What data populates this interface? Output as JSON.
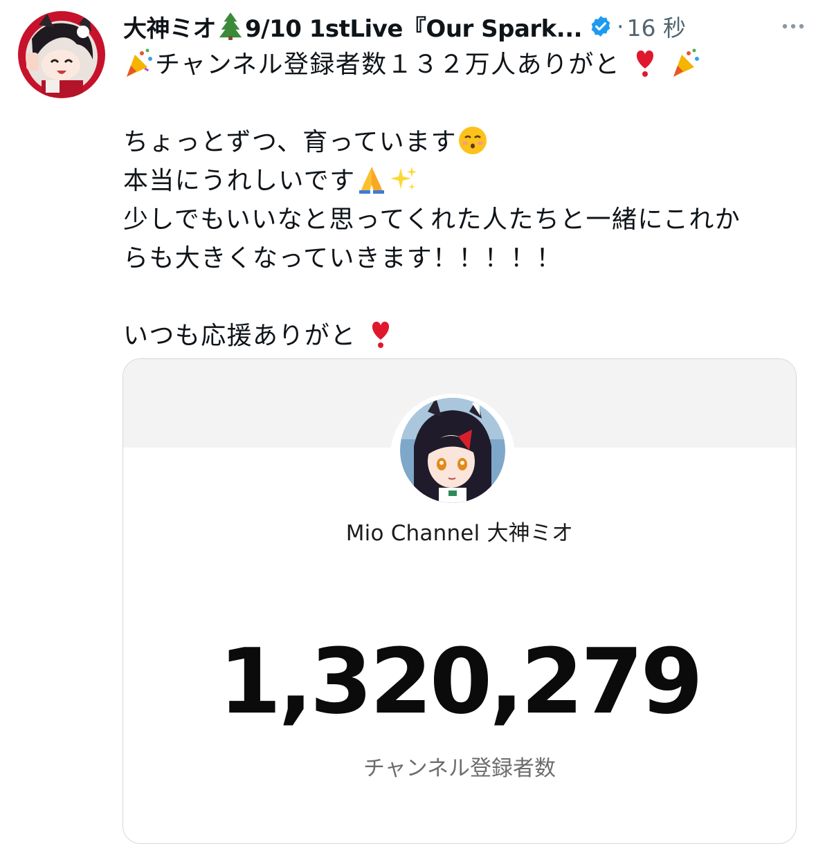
{
  "tweet": {
    "display_name": "大神ミオ",
    "display_name_suffix": "9/10 1stLive『Our Spark...",
    "separator": "·",
    "timestamp": "16 秒",
    "lines": {
      "l1": "チャンネル登録者数１３２万人ありがと",
      "l2": "ちょっとずつ、育っています",
      "l3": "本当にうれしいです",
      "l4": "少しでもいいなと思ってくれた人たちと一緒にこれか",
      "l5": "らも大きくなっていきます！！！！！",
      "l6": "いつも応援ありがと"
    },
    "icons": {
      "tree": "christmas-tree-emoji",
      "verified": "verified-badge-icon",
      "more": "more-options-icon",
      "party": "party-popper-emoji",
      "heart": "heavy-heart-exclamation-emoji",
      "kiss": "kissing-smiling-eyes-emoji",
      "pray": "folded-hands-emoji",
      "sparkles": "sparkles-emoji"
    }
  },
  "media": {
    "channel_name": "Mio Channel 大神ミオ",
    "subscriber_count": "1,320,279",
    "subscriber_label": "チャンネル登録者数"
  },
  "colors": {
    "text": "#0f1419",
    "secondary": "#536471",
    "verified": "#1d9bf0",
    "card_border": "#cfd9de"
  }
}
